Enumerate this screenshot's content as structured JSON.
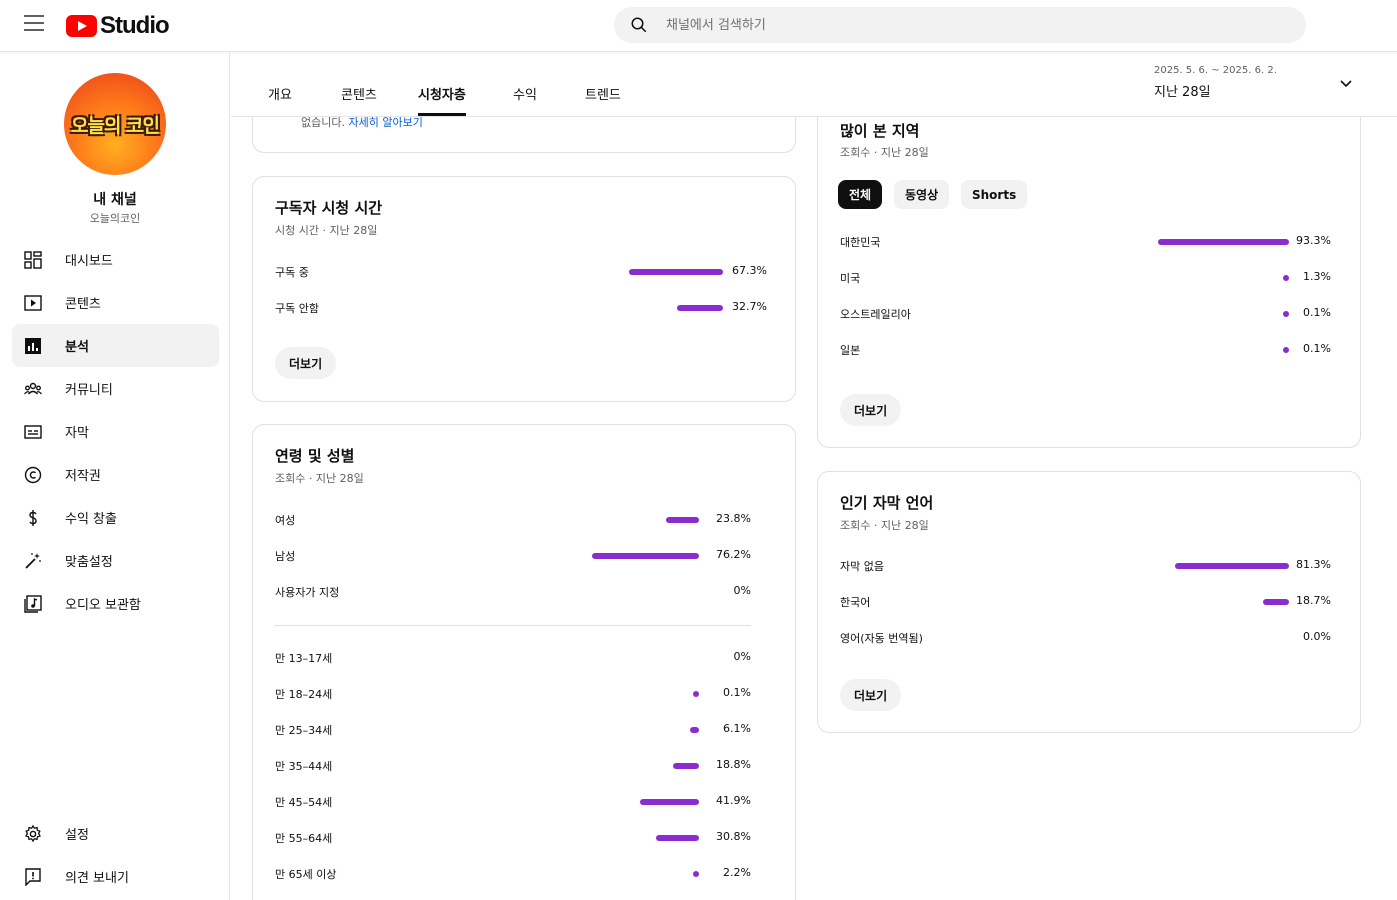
{
  "app": {
    "logo_text": "Studio"
  },
  "search": {
    "placeholder": "채널에서 검색하기"
  },
  "channel": {
    "name": "내 채널",
    "handle": "오늘의코인",
    "avatar_text": "오늘의 코인"
  },
  "sidebar": {
    "items": [
      {
        "label": "대시보드",
        "icon": "dashboard-icon"
      },
      {
        "label": "콘텐츠",
        "icon": "content-icon"
      },
      {
        "label": "분석",
        "icon": "analytics-icon",
        "active": true
      },
      {
        "label": "커뮤니티",
        "icon": "community-icon"
      },
      {
        "label": "자막",
        "icon": "subtitles-icon"
      },
      {
        "label": "저작권",
        "icon": "copyright-icon"
      },
      {
        "label": "수익 창출",
        "icon": "monetization-icon"
      },
      {
        "label": "맞춤설정",
        "icon": "customization-icon"
      },
      {
        "label": "오디오 보관함",
        "icon": "audio-library-icon"
      }
    ],
    "bottom": [
      {
        "label": "설정",
        "icon": "settings-icon"
      },
      {
        "label": "의견 보내기",
        "icon": "feedback-icon"
      }
    ]
  },
  "tabs": [
    "개요",
    "콘텐츠",
    "시청자층",
    "수익",
    "트렌드"
  ],
  "active_tab": "시청자층",
  "date": {
    "range": "2025. 5. 6. ~ 2025. 6. 2.",
    "label": "지난 28일"
  },
  "partial_card": {
    "text": "없습니다.",
    "link": "자세히 알아보기"
  },
  "subscriber_watch": {
    "title": "구독자 시청 시간",
    "subtitle": "시청 시간 · 지난 28일",
    "rows": [
      {
        "label": "구독 중",
        "value": "67.3%",
        "pct": 67.3
      },
      {
        "label": "구독 안함",
        "value": "32.7%",
        "pct": 32.7
      }
    ],
    "more": "더보기"
  },
  "age_gender": {
    "title": "연령 및 성별",
    "subtitle": "조회수 · 지난 28일",
    "gender_rows": [
      {
        "label": "여성",
        "value": "23.8%",
        "pct": 23.8
      },
      {
        "label": "남성",
        "value": "76.2%",
        "pct": 76.2
      },
      {
        "label": "사용자가 지정",
        "value": "0%",
        "pct": 0
      }
    ],
    "age_rows": [
      {
        "label": "만 13–17세",
        "value": "0%",
        "pct": 0
      },
      {
        "label": "만 18–24세",
        "value": "0.1%",
        "pct": 0.1
      },
      {
        "label": "만 25–34세",
        "value": "6.1%",
        "pct": 6.1
      },
      {
        "label": "만 35–44세",
        "value": "18.8%",
        "pct": 18.8
      },
      {
        "label": "만 45–54세",
        "value": "41.9%",
        "pct": 41.9
      },
      {
        "label": "만 55–64세",
        "value": "30.8%",
        "pct": 30.8
      },
      {
        "label": "만 65세 이상",
        "value": "2.2%",
        "pct": 2.2
      }
    ]
  },
  "top_geographies": {
    "title": "많이 본 지역",
    "subtitle": "조회수 · 지난 28일",
    "chips": [
      "전체",
      "동영상",
      "Shorts"
    ],
    "active_chip": "전체",
    "rows": [
      {
        "label": "대한민국",
        "value": "93.3%",
        "pct": 93.3
      },
      {
        "label": "미국",
        "value": "1.3%",
        "pct": 1.3
      },
      {
        "label": "오스트레일리아",
        "value": "0.1%",
        "pct": 0.1
      },
      {
        "label": "일본",
        "value": "0.1%",
        "pct": 0.1
      }
    ],
    "more": "더보기"
  },
  "subtitle_languages": {
    "title": "인기 자막 언어",
    "subtitle": "조회수 · 지난 28일",
    "rows": [
      {
        "label": "자막 없음",
        "value": "81.3%",
        "pct": 81.3
      },
      {
        "label": "한국어",
        "value": "18.7%",
        "pct": 18.7
      },
      {
        "label": "영어(자동 번역됨)",
        "value": "0.0%",
        "pct": 0
      }
    ],
    "more": "더보기"
  },
  "colors": {
    "accent": "#8a2ccf",
    "brand": "#ff0000"
  }
}
